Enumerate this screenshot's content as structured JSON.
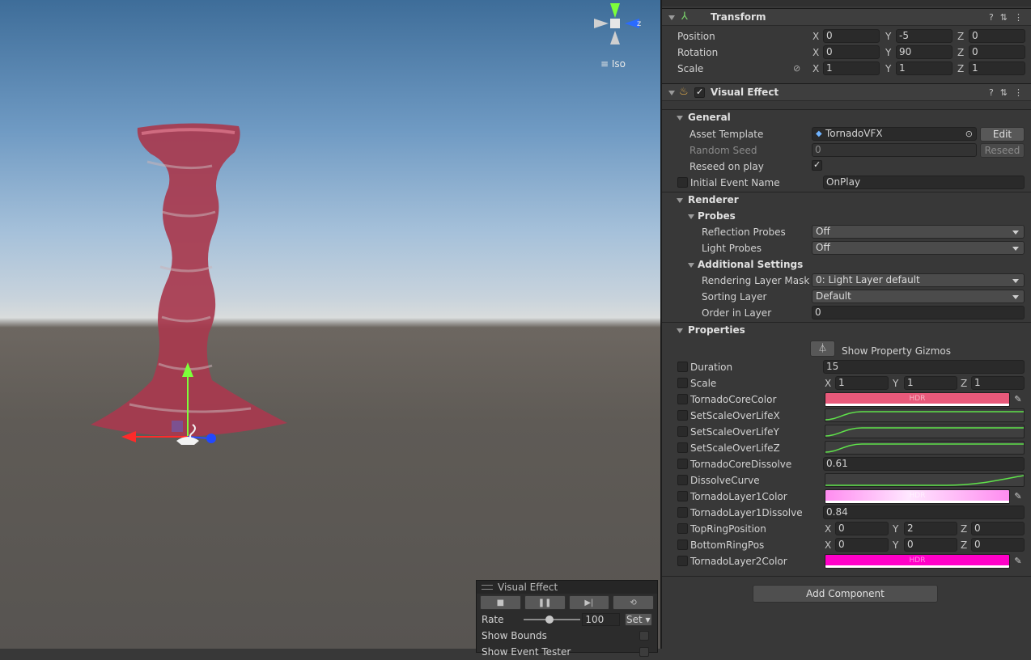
{
  "scene": {
    "gizmo_axis_label": "z",
    "projection_label": "Iso"
  },
  "overlay": {
    "title": "Visual Effect",
    "rate_label": "Rate",
    "rate_value": "100",
    "set_label": "Set",
    "rate_fraction": 0.45,
    "show_bounds_label": "Show Bounds",
    "show_event_tester_label": "Show Event Tester"
  },
  "transform": {
    "title": "Transform",
    "position": {
      "label": "Position",
      "x": "0",
      "y": "-5",
      "z": "0"
    },
    "rotation": {
      "label": "Rotation",
      "x": "0",
      "y": "90",
      "z": "0"
    },
    "scale": {
      "label": "Scale",
      "x": "1",
      "y": "1",
      "z": "1"
    }
  },
  "axes": {
    "x": "X",
    "y": "Y",
    "z": "Z"
  },
  "visual_effect": {
    "title": "Visual Effect",
    "general": {
      "title": "General",
      "asset_template_label": "Asset Template",
      "asset_template_value": "TornadoVFX",
      "edit_label": "Edit",
      "random_seed_label": "Random Seed",
      "random_seed_value": "0",
      "reseed_label": "Reseed",
      "reseed_on_play_label": "Reseed on play",
      "initial_event_label": "Initial Event Name",
      "initial_event_value": "OnPlay"
    },
    "renderer": {
      "title": "Renderer",
      "probes_title": "Probes",
      "reflection_probes_label": "Reflection Probes",
      "reflection_probes_value": "Off",
      "light_probes_label": "Light Probes",
      "light_probes_value": "Off",
      "additional_title": "Additional Settings",
      "rendering_layer_mask_label": "Rendering Layer Mask",
      "rendering_layer_mask_value": "0: Light Layer default",
      "sorting_layer_label": "Sorting Layer",
      "sorting_layer_value": "Default",
      "order_in_layer_label": "Order in Layer",
      "order_in_layer_value": "0"
    },
    "properties": {
      "title": "Properties",
      "gizmos_label": "Show Property Gizmos",
      "hdr_label": "HDR",
      "duration": {
        "label": "Duration",
        "value": "15"
      },
      "scale": {
        "label": "Scale",
        "x": "1",
        "y": "1",
        "z": "1"
      },
      "core_color": {
        "label": "TornadoCoreColor",
        "color": "#e8597a"
      },
      "scale_x": {
        "label": "SetScaleOverLifeX"
      },
      "scale_y": {
        "label": "SetScaleOverLifeY"
      },
      "scale_z": {
        "label": "SetScaleOverLifeZ"
      },
      "core_dissolve": {
        "label": "TornadoCoreDissolve",
        "value": "0.61"
      },
      "dissolve_curve": {
        "label": "DissolveCurve"
      },
      "layer1_color": {
        "label": "TornadoLayer1Color",
        "color": "#ff8cf0"
      },
      "layer1_dissolve": {
        "label": "TornadoLayer1Dissolve",
        "value": "0.84"
      },
      "top_ring": {
        "label": "TopRingPosition",
        "x": "0",
        "y": "2",
        "z": "0"
      },
      "bottom_ring": {
        "label": "BottomRingPos",
        "x": "0",
        "y": "0",
        "z": "0"
      },
      "layer2_color": {
        "label": "TornadoLayer2Color",
        "color": "#ff00c8"
      }
    }
  },
  "add_component_label": "Add Component"
}
